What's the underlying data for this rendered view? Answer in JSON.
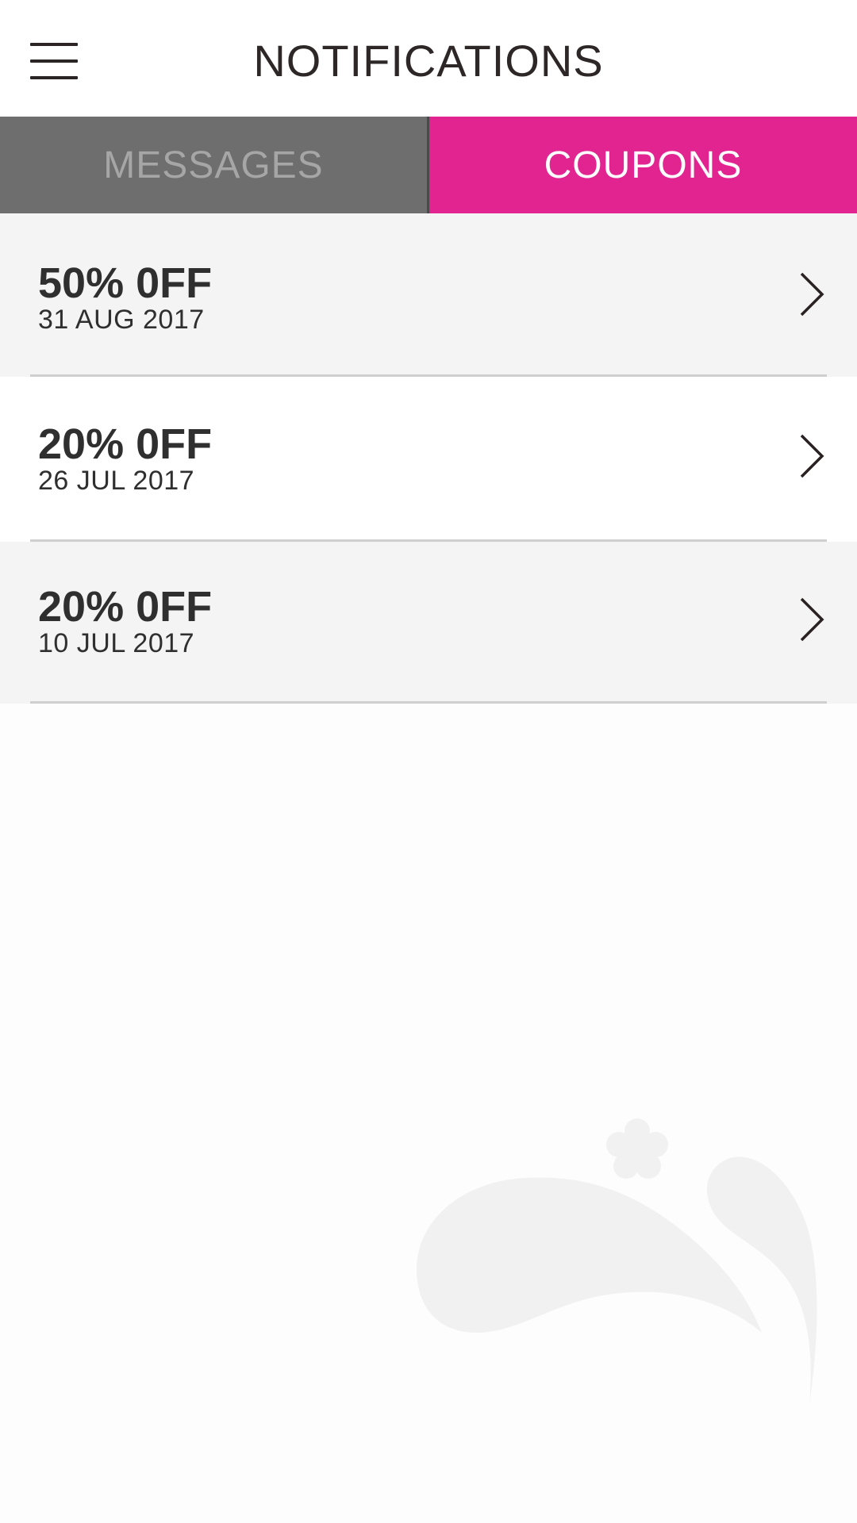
{
  "header": {
    "title": "NOTIFICATIONS",
    "menu_icon": "hamburger-menu-icon"
  },
  "tabs": [
    {
      "label": "MESSAGES",
      "active": false
    },
    {
      "label": "COUPONS",
      "active": true
    }
  ],
  "coupons": [
    {
      "label": "50% 0FF",
      "date": "31 AUG 2017"
    },
    {
      "label": "20% 0FF",
      "date": "26 JUL 2017"
    },
    {
      "label": "20% 0FF",
      "date": "10 JUL 2017"
    }
  ],
  "colors": {
    "accent": "#e22491",
    "inactive_tab": "#6e6e6e",
    "text": "#2f2f2f",
    "row_alt": "#f4f4f4",
    "watermark": "#f1f1f1"
  },
  "icons": {
    "row_arrow": "chevron-right-icon",
    "watermark": "brand-splash-logo-icon"
  }
}
